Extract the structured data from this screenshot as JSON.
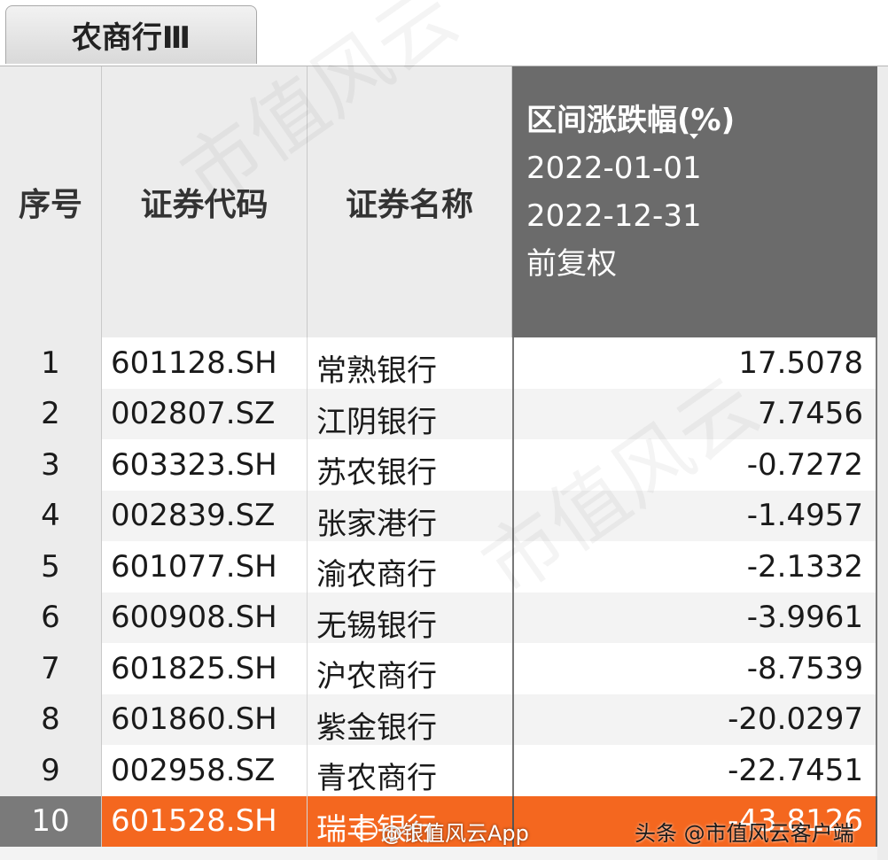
{
  "tab": {
    "label": "农商行Ⅲ"
  },
  "header": {
    "seq": "序号",
    "code": "证券代码",
    "name": "证券名称",
    "change_title": "区间涨跌幅(%)",
    "change_start": "2022-01-01",
    "change_end": "2022-12-31",
    "change_adj": "前复权"
  },
  "rows": [
    {
      "seq": "1",
      "code": "601128.SH",
      "name": "常熟银行",
      "change": "17.5078"
    },
    {
      "seq": "2",
      "code": "002807.SZ",
      "name": "江阴银行",
      "change": "7.7456"
    },
    {
      "seq": "3",
      "code": "603323.SH",
      "name": "苏农银行",
      "change": "-0.7272"
    },
    {
      "seq": "4",
      "code": "002839.SZ",
      "name": "张家港行",
      "change": "-1.4957"
    },
    {
      "seq": "5",
      "code": "601077.SH",
      "name": "渝农商行",
      "change": "-2.1332"
    },
    {
      "seq": "6",
      "code": "600908.SH",
      "name": "无锡银行",
      "change": "-3.9961"
    },
    {
      "seq": "7",
      "code": "601825.SH",
      "name": "沪农商行",
      "change": "-8.7539"
    },
    {
      "seq": "8",
      "code": "601860.SH",
      "name": "紫金银行",
      "change": "-20.0297"
    },
    {
      "seq": "9",
      "code": "002958.SZ",
      "name": "青农商行",
      "change": "-22.7451"
    },
    {
      "seq": "10",
      "code": "601528.SH",
      "name": "瑞丰银行",
      "change": "-43.8126"
    }
  ],
  "watermarks": {
    "weibo": "@银值风云App",
    "toutiao": "头条 @市值风云客户端",
    "background": "市值风云"
  },
  "colors": {
    "header_dark": "#6b6b6b",
    "highlight": "#f4671f"
  }
}
